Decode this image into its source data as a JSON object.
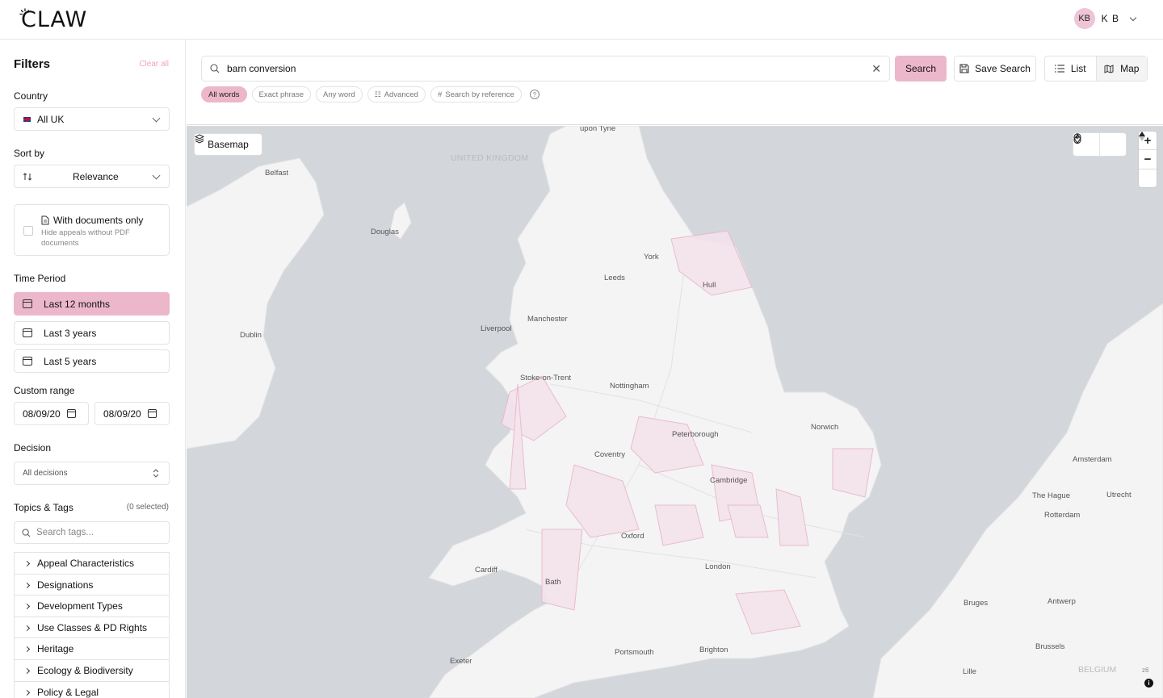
{
  "header": {
    "logo_text": "CLAW",
    "user_initials": "KB",
    "user_name": "K B"
  },
  "sidebar": {
    "title": "Filters",
    "clear_all": "Clear all",
    "country_label": "Country",
    "country_value": "All UK",
    "sort_label": "Sort by",
    "sort_value": "Relevance",
    "docs_title": "With documents only",
    "docs_desc": "Hide appeals without PDF documents",
    "time_label": "Time Period",
    "periods": [
      "Last 12 months",
      "Last 3 years",
      "Last 5 years"
    ],
    "custom_label": "Custom range",
    "date_from": "08/09/20",
    "date_to": "08/09/20",
    "decision_label": "Decision",
    "decision_value": "All decisions",
    "topics_label": "Topics & Tags",
    "topics_count": "(0 selected)",
    "tag_search_placeholder": "Search tags...",
    "tag_groups": [
      "Appeal Characteristics",
      "Designations",
      "Development Types",
      "Use Classes & PD Rights",
      "Heritage",
      "Ecology & Biodiversity",
      "Policy & Legal"
    ]
  },
  "search": {
    "value": "barn conversion",
    "search_button": "Search",
    "save_button": "Save Search",
    "view_list": "List",
    "view_map": "Map",
    "modes": [
      "All words",
      "Exact phrase",
      "Any word",
      "Advanced",
      "Search by reference"
    ]
  },
  "map": {
    "basemap_button": "Basemap",
    "zoom_label": "z6",
    "places": [
      {
        "name": "upon Tyne"
      },
      {
        "name": "UNITED KINGDOM"
      },
      {
        "name": "Belfast"
      },
      {
        "name": "Douglas"
      },
      {
        "name": "York"
      },
      {
        "name": "Leeds"
      },
      {
        "name": "Hull"
      },
      {
        "name": "Manchester"
      },
      {
        "name": "Liverpool"
      },
      {
        "name": "Dublin"
      },
      {
        "name": "Stoke-on-Trent"
      },
      {
        "name": "Nottingham"
      },
      {
        "name": "Norwich"
      },
      {
        "name": "Peterborough"
      },
      {
        "name": "Coventry"
      },
      {
        "name": "Cambridge"
      },
      {
        "name": "Amsterdam"
      },
      {
        "name": "The Hague"
      },
      {
        "name": "Utrecht"
      },
      {
        "name": "Rotterdam"
      },
      {
        "name": "Oxford"
      },
      {
        "name": "London"
      },
      {
        "name": "Cardiff"
      },
      {
        "name": "Bath"
      },
      {
        "name": "Bruges"
      },
      {
        "name": "Antwerp"
      },
      {
        "name": "Portsmouth"
      },
      {
        "name": "Brighton"
      },
      {
        "name": "Brussels"
      },
      {
        "name": "Exeter"
      },
      {
        "name": "Lille"
      },
      {
        "name": "BELGIUM"
      }
    ]
  }
}
